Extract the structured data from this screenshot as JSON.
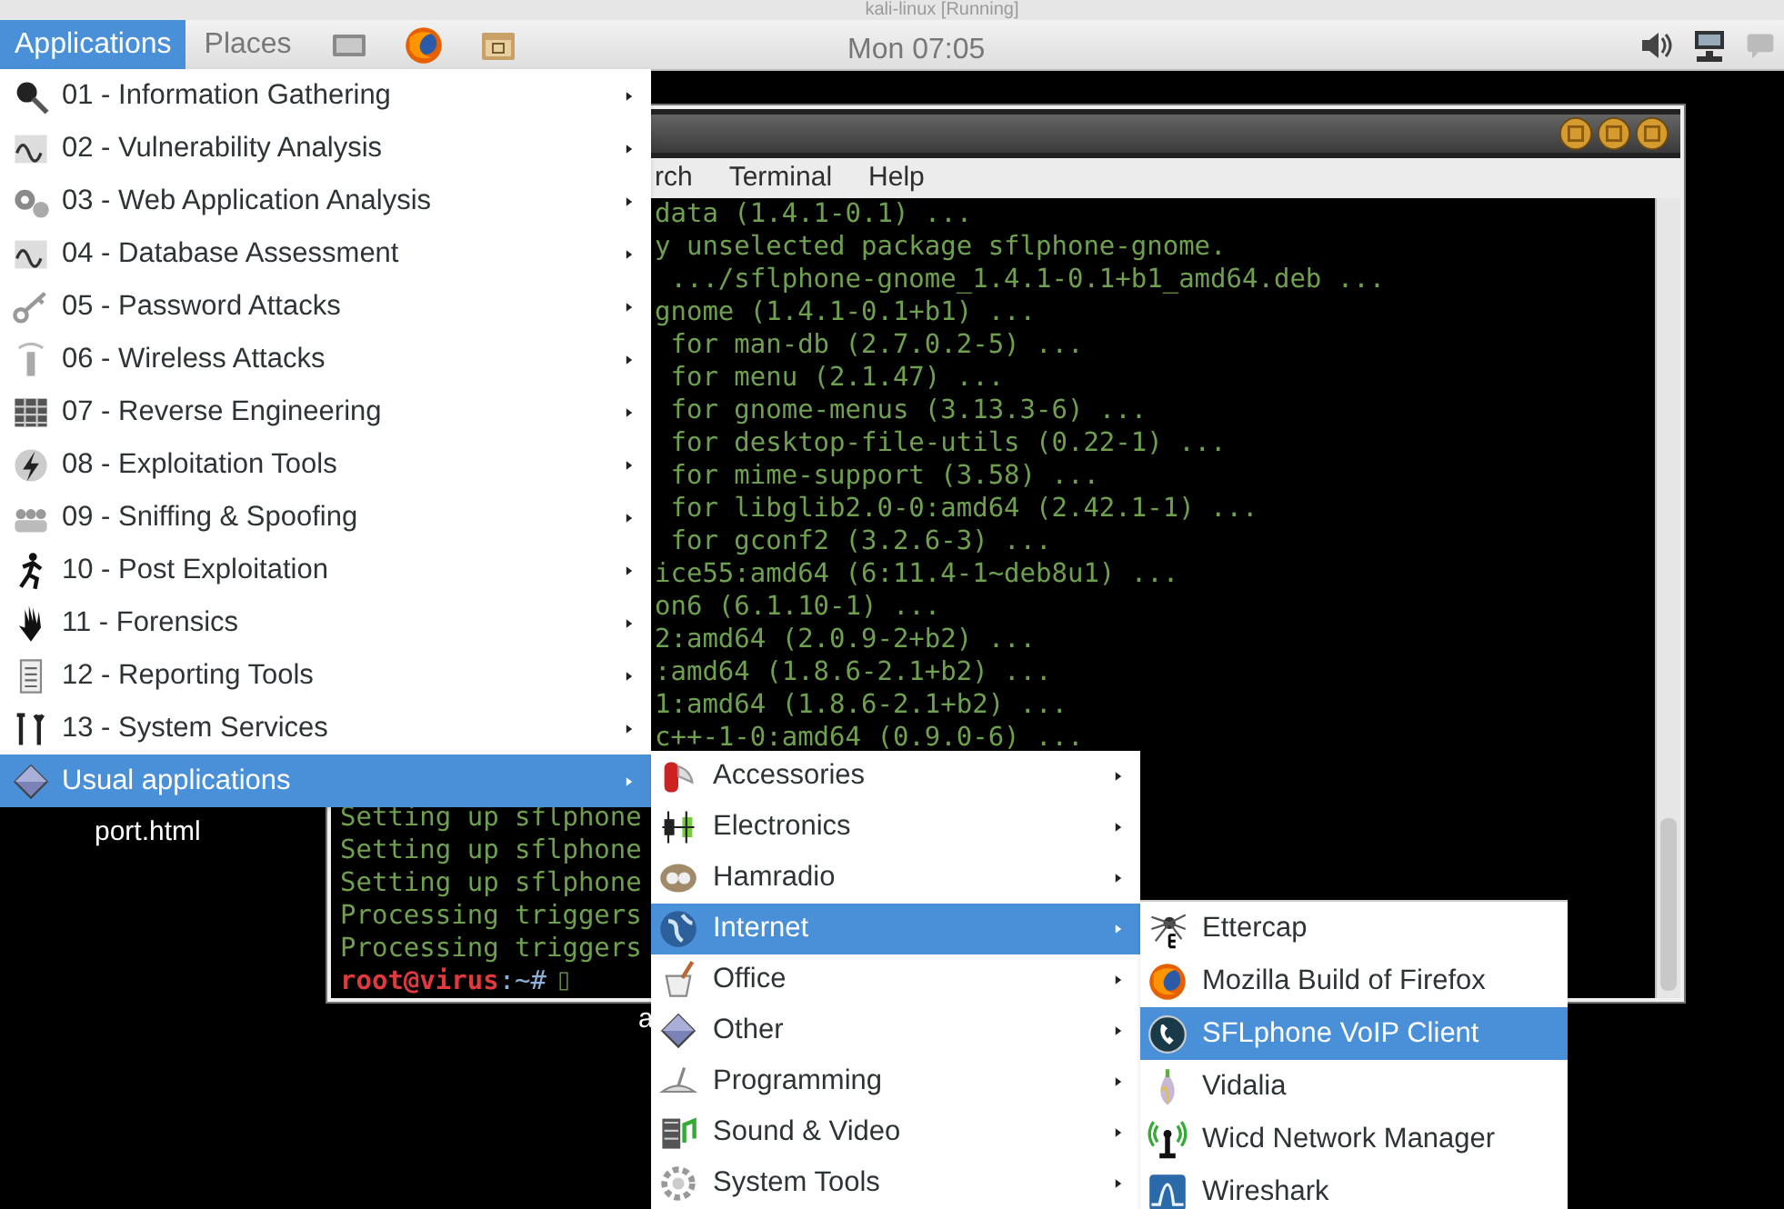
{
  "vm_window": {
    "title": "kali-linux [Running]"
  },
  "panel": {
    "applications": {
      "label": "Applications",
      "selected": true
    },
    "places": {
      "label": "Places",
      "selected": false
    },
    "clock": "Mon 07:05"
  },
  "terminal": {
    "menu": [
      "rch",
      "Terminal",
      "Help"
    ],
    "lines": [
      {
        "kind": "right",
        "text": "data (1.4.1-0.1) ..."
      },
      {
        "kind": "right",
        "text": "y unselected package sflphone-gnome."
      },
      {
        "kind": "right",
        "text": " .../sflphone-gnome_1.4.1-0.1+b1_amd64.deb ..."
      },
      {
        "kind": "right",
        "text": "gnome (1.4.1-0.1+b1) ..."
      },
      {
        "kind": "right",
        "text": " for man-db (2.7.0.2-5) ..."
      },
      {
        "kind": "right",
        "text": " for menu (2.1.47) ..."
      },
      {
        "kind": "right",
        "text": " for gnome-menus (3.13.3-6) ..."
      },
      {
        "kind": "right",
        "text": " for desktop-file-utils (0.22-1) ..."
      },
      {
        "kind": "right",
        "text": " for mime-support (3.58) ..."
      },
      {
        "kind": "right",
        "text": " for libglib2.0-0:amd64 (2.42.1-1) ..."
      },
      {
        "kind": "right",
        "text": " for gconf2 (3.2.6-3) ..."
      },
      {
        "kind": "right",
        "text": "ice55:amd64 (6:11.4-1~deb8u1) ..."
      },
      {
        "kind": "right",
        "text": "on6 (6.1.10-1) ..."
      },
      {
        "kind": "right",
        "text": "2:amd64 (2.0.9-2+b2) ..."
      },
      {
        "kind": "right",
        "text": ":amd64 (1.8.6-2.1+b2) ..."
      },
      {
        "kind": "right",
        "text": "1:amd64 (1.8.6-2.1+b2) ..."
      },
      {
        "kind": "right",
        "text": "c++-1-0:amd64 (0.9.0-6) ..."
      },
      {
        "kind": "left",
        "text": "Setting up sflphone"
      },
      {
        "kind": "left",
        "text": "Setting up sflphone"
      },
      {
        "kind": "left",
        "text": "Setting up sflphone"
      },
      {
        "kind": "left",
        "text": "Processing triggers"
      },
      {
        "kind": "left",
        "text": "Processing triggers"
      }
    ],
    "prompt": {
      "user": "root@virus",
      "path": ":~#"
    }
  },
  "desktop_icons": [
    {
      "label": "port.html"
    },
    {
      "label": "a"
    }
  ],
  "menus": [
    {
      "items": [
        {
          "label": "01 - Information Gathering",
          "submenu": true,
          "selected": false
        },
        {
          "label": "02 - Vulnerability Analysis",
          "submenu": true,
          "selected": false
        },
        {
          "label": "03 - Web Application Analysis",
          "submenu": true,
          "selected": false
        },
        {
          "label": "04 - Database Assessment",
          "submenu": true,
          "selected": false
        },
        {
          "label": "05 - Password Attacks",
          "submenu": true,
          "selected": false
        },
        {
          "label": "06 - Wireless Attacks",
          "submenu": true,
          "selected": false
        },
        {
          "label": "07 - Reverse Engineering",
          "submenu": true,
          "selected": false
        },
        {
          "label": "08 - Exploitation Tools",
          "submenu": true,
          "selected": false
        },
        {
          "label": "09 - Sniffing & Spoofing",
          "submenu": true,
          "selected": false
        },
        {
          "label": "10 - Post Exploitation",
          "submenu": true,
          "selected": false
        },
        {
          "label": "11 - Forensics",
          "submenu": true,
          "selected": false
        },
        {
          "label": "12 - Reporting Tools",
          "submenu": true,
          "selected": false
        },
        {
          "label": "13 - System Services",
          "submenu": true,
          "selected": false
        },
        {
          "label": "Usual applications",
          "submenu": true,
          "selected": true
        }
      ]
    },
    {
      "items": [
        {
          "label": "Accessories",
          "submenu": true,
          "selected": false
        },
        {
          "label": "Electronics",
          "submenu": true,
          "selected": false
        },
        {
          "label": "Hamradio",
          "submenu": true,
          "selected": false
        },
        {
          "label": "Internet",
          "submenu": true,
          "selected": true
        },
        {
          "label": "Office",
          "submenu": true,
          "selected": false
        },
        {
          "label": "Other",
          "submenu": true,
          "selected": false
        },
        {
          "label": "Programming",
          "submenu": true,
          "selected": false
        },
        {
          "label": "Sound & Video",
          "submenu": true,
          "selected": false
        },
        {
          "label": "System Tools",
          "submenu": true,
          "selected": false
        }
      ]
    },
    {
      "items": [
        {
          "label": "Ettercap",
          "submenu": false,
          "selected": false
        },
        {
          "label": "Mozilla Build of Firefox",
          "submenu": false,
          "selected": false
        },
        {
          "label": "SFLphone VoIP Client",
          "submenu": false,
          "selected": true
        },
        {
          "label": "Vidalia",
          "submenu": false,
          "selected": false
        },
        {
          "label": "Wicd Network Manager",
          "submenu": false,
          "selected": false
        },
        {
          "label": "Wireshark",
          "submenu": false,
          "selected": false
        }
      ]
    }
  ]
}
